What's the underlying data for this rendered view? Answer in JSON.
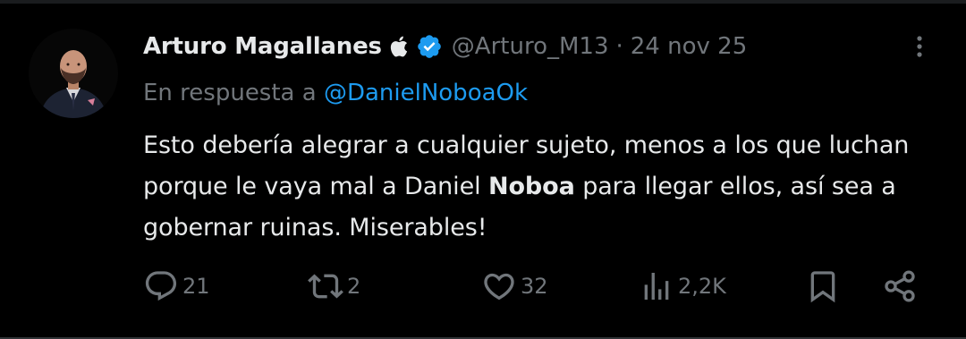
{
  "tweet": {
    "author": {
      "display_name": "Arturo Magallanes",
      "handle": "@Arturo_M13",
      "badge_icon": "apple-icon",
      "verified_icon": "verified-badge-icon",
      "verified_color": "#1d9bf0"
    },
    "separator": "·",
    "date": "24 nov 25",
    "reply_to": {
      "prefix": "En respuesta a",
      "handle": "@DanielNoboaOk"
    },
    "text": {
      "part1": "Esto debería alegrar a cualquier sujeto, menos a los que luchan porque le vaya mal a Daniel ",
      "bold": "Noboa",
      "part2": " para llegar ellos, así sea a gobernar ruinas. Miserables!"
    },
    "actions": {
      "replies": "21",
      "reposts": "2",
      "likes": "32",
      "views": "2,2K"
    }
  },
  "colors": {
    "background": "#000000",
    "primary_text": "#e7e9ea",
    "secondary_text": "#71767b",
    "link": "#1d9bf0"
  }
}
